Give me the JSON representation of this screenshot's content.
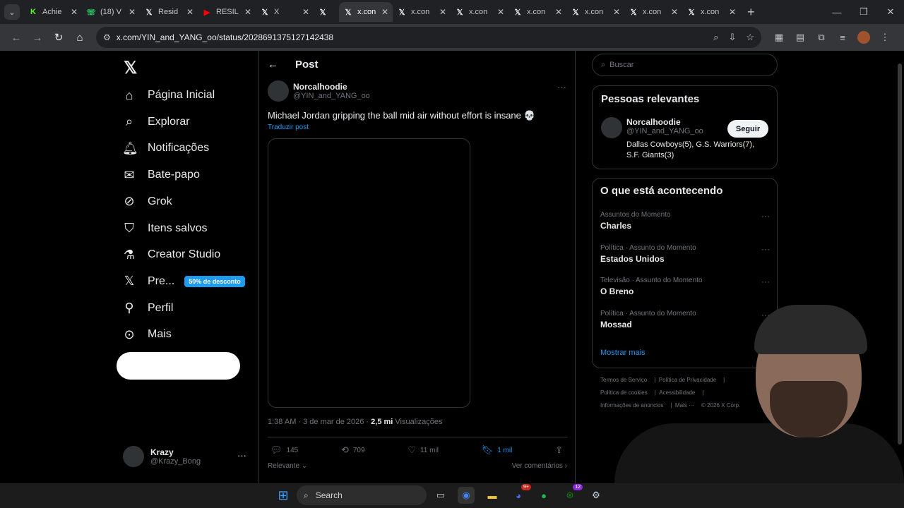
{
  "browser": {
    "tabs": [
      {
        "title": "Achie",
        "favicon": "K",
        "favcolor": "#53fc18"
      },
      {
        "title": "(18) V",
        "favicon": "☏",
        "favcolor": "#25d366"
      },
      {
        "title": "Resid",
        "favicon": "𝕏",
        "favcolor": "#e8eaed"
      },
      {
        "title": "RESIL",
        "favicon": "▶",
        "favcolor": "#ff0000"
      },
      {
        "title": "X",
        "favicon": "𝕏",
        "favcolor": "#e8eaed"
      },
      {
        "title": "",
        "favicon": "𝕏",
        "favcolor": "#e8eaed"
      },
      {
        "title": "x.con",
        "favicon": "𝕏",
        "favcolor": "#e8eaed",
        "active": true
      },
      {
        "title": "x.con",
        "favicon": "𝕏",
        "favcolor": "#e8eaed"
      },
      {
        "title": "x.con",
        "favicon": "𝕏",
        "favcolor": "#e8eaed"
      },
      {
        "title": "x.con",
        "favicon": "𝕏",
        "favcolor": "#e8eaed"
      },
      {
        "title": "x.con",
        "favicon": "𝕏",
        "favcolor": "#e8eaed"
      },
      {
        "title": "x.con",
        "favicon": "𝕏",
        "favcolor": "#e8eaed"
      },
      {
        "title": "x.con",
        "favicon": "𝕏",
        "favcolor": "#e8eaed"
      }
    ],
    "url": "x.com/YIN_and_YANG_oo/status/2028691375127142438"
  },
  "nav": {
    "items": [
      {
        "label": "Página Inicial",
        "icon": "home-icon",
        "glyph": "⌂"
      },
      {
        "label": "Explorar",
        "icon": "search-icon",
        "glyph": "⌕"
      },
      {
        "label": "Notificações",
        "icon": "bell-icon",
        "glyph": "🔔︎"
      },
      {
        "label": "Bate-papo",
        "icon": "mail-icon",
        "glyph": "✉"
      },
      {
        "label": "Grok",
        "icon": "grok-icon",
        "glyph": "⊘"
      },
      {
        "label": "Itens salvos",
        "icon": "bookmark-icon",
        "glyph": "⛉"
      },
      {
        "label": "Creator Studio",
        "icon": "flask-icon",
        "glyph": "⚗"
      },
      {
        "label": "Pre...",
        "icon": "x-premium-icon",
        "glyph": "𝕏"
      },
      {
        "label": "Perfil",
        "icon": "person-icon",
        "glyph": "⚲"
      },
      {
        "label": "Mais",
        "icon": "more-circle-icon",
        "glyph": "⊙"
      }
    ],
    "promo": "50% de desconto"
  },
  "account": {
    "name": "Krazy",
    "handle": "@Krazy_Bong"
  },
  "post": {
    "header": "Post",
    "author_name": "Norcalhoodie",
    "author_handle": "@YIN_and_YANG_oo",
    "text": "Michael Jordan gripping the ball mid air without effort is insane 💀",
    "translate": "Traduzir post",
    "time": "1:38 AM · 3 de mar de 2026 · ",
    "views_count": "2,5 mi",
    "views_label": " Visualizações",
    "replies": "145",
    "reposts": "709",
    "likes": "11 mil",
    "bookmarks": "1 mil",
    "sort": "Relevante",
    "see_replies": "Ver comentários"
  },
  "sidebar": {
    "search_placeholder": "Buscar",
    "relevant_title": "Pessoas relevantes",
    "relevant_name": "Norcalhoodie",
    "relevant_handle": "@YIN_and_YANG_oo",
    "relevant_bio": "Dallas Cowboys(5), G.S. Warriors(7), S.F. Giants(3)",
    "follow": "Seguir",
    "trends_title": "O que está acontecendo",
    "trends": [
      {
        "category": "Assuntos do Momento",
        "name": "Charles"
      },
      {
        "category": "Política · Assunto do Momento",
        "name": "Estados Unidos"
      },
      {
        "category": "Televisão · Assunto do Momento",
        "name": "O Breno"
      },
      {
        "category": "Política · Assunto do Momento",
        "name": "Mossad"
      }
    ],
    "show_more": "Mostrar mais",
    "footer": [
      "Termos de Serviço",
      "Política de Privacidade",
      "Política de cookies",
      "Acessibilidade",
      "Informações de anúncios",
      "Mais ···",
      "© 2026 X Corp."
    ]
  },
  "taskbar": {
    "search": "Search"
  }
}
